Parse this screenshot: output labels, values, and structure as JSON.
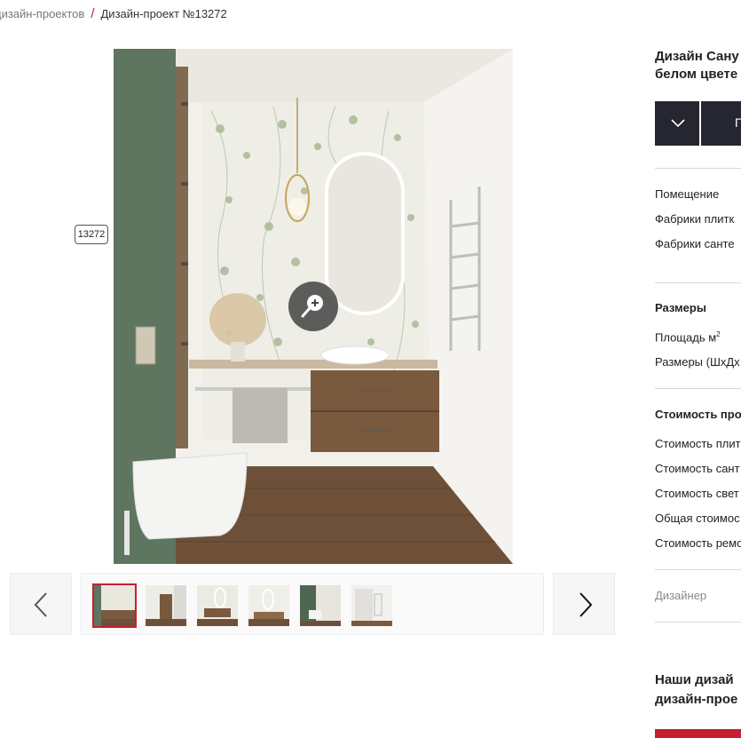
{
  "breadcrumb": {
    "parent": "дизайн-проектов",
    "separator": "/",
    "current": "Дизайн-проект №13272"
  },
  "project_id_tag": "13272",
  "gallery": {
    "prev_icon": "chevron-left-icon",
    "next_icon": "chevron-right-icon",
    "zoom_icon": "zoom-in-icon",
    "active_thumb": 1,
    "thumb_count": 6
  },
  "sidebar": {
    "title_line1": "Дизайн Сану",
    "title_line2": "белом цвете",
    "dropdown_icon": "chevron-down-icon",
    "button_label": "П",
    "info_rows": [
      "Помещение",
      "Фабрики плитк",
      "Фабрики санте"
    ],
    "sizes_heading": "Размеры",
    "area_label": "Площадь м",
    "area_sup": "2",
    "dims_label": "Размеры (ШхДх",
    "cost_heading": "Стоимость про",
    "cost_rows": [
      "Стоимость плит",
      "Стоимость сант",
      "Стоимость свет",
      "Общая стоимос",
      "Стоимость ремо"
    ],
    "designer_label": "Дизайнер",
    "bottom_line1": "Наши дизай",
    "bottom_line2": "дизайн-прое"
  },
  "colors": {
    "accent": "#c4202f",
    "dark_bar": "#262630",
    "wall_green": "#5e7560",
    "wood": "#7a5a3e"
  }
}
